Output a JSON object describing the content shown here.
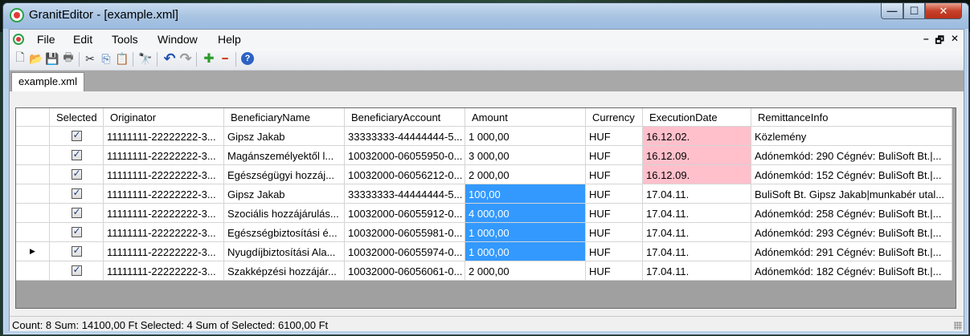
{
  "window": {
    "title": "GranitEditor - [example.xml]",
    "caption_min": "—",
    "caption_max": "☐",
    "caption_close": "✕"
  },
  "menu": [
    "File",
    "Edit",
    "Tools",
    "Window",
    "Help"
  ],
  "mdi_controls": [
    "–",
    "🗗",
    "✕"
  ],
  "toolbar": [
    {
      "name": "new-icon",
      "glyph": "🗋"
    },
    {
      "name": "open-icon",
      "glyph": "📂"
    },
    {
      "name": "save-icon",
      "glyph": "💾"
    },
    {
      "name": "print-icon",
      "glyph": "🖶"
    },
    {
      "name": "cut-icon",
      "glyph": "✂"
    },
    {
      "name": "copy-icon",
      "glyph": "⎘"
    },
    {
      "name": "paste-icon",
      "glyph": "📋"
    },
    {
      "name": "find-icon",
      "glyph": "🔭"
    },
    {
      "name": "undo-icon",
      "glyph": "↶"
    },
    {
      "name": "redo-icon",
      "glyph": "↷"
    },
    {
      "name": "add-icon",
      "glyph": "✚"
    },
    {
      "name": "remove-icon",
      "glyph": "━"
    },
    {
      "name": "help-icon",
      "glyph": "?"
    }
  ],
  "tab": {
    "label": "example.xml"
  },
  "grid": {
    "columns": [
      "Selected",
      "Originator",
      "BeneficiaryName",
      "BeneficiaryAccount",
      "Amount",
      "Currency",
      "ExecutionDate",
      "RemittanceInfo"
    ],
    "rows": [
      {
        "selected": true,
        "originator": "11111111-22222222-3...",
        "name": "Gipsz Jakab",
        "account": "33333333-44444444-5...",
        "amount": "1 000,00",
        "currency": "HUF",
        "date": "16.12.02.",
        "info": "Közlemény",
        "amount_sel": false,
        "date_pink": true,
        "current": false
      },
      {
        "selected": true,
        "originator": "11111111-22222222-3...",
        "name": "Magánszemélyektől l...",
        "account": "10032000-06055950-0...",
        "amount": "3 000,00",
        "currency": "HUF",
        "date": "16.12.09.",
        "info": "Adónemkód: 290 Cégnév: BuliSoft Bt.|...",
        "amount_sel": false,
        "date_pink": true,
        "current": false
      },
      {
        "selected": true,
        "originator": "11111111-22222222-3...",
        "name": "Egészségügyi hozzáj...",
        "account": "10032000-06056212-0...",
        "amount": "2 000,00",
        "currency": "HUF",
        "date": "16.12.09.",
        "info": "Adónemkód: 152 Cégnév: BuliSoft Bt.|...",
        "amount_sel": false,
        "date_pink": true,
        "current": false
      },
      {
        "selected": true,
        "originator": "11111111-22222222-3...",
        "name": "Gipsz Jakab",
        "account": "33333333-44444444-5...",
        "amount": "100,00",
        "currency": "HUF",
        "date": "17.04.11.",
        "info": "BuliSoft Bt. Gipsz Jakab|munkabér utal...",
        "amount_sel": true,
        "date_pink": false,
        "current": false
      },
      {
        "selected": true,
        "originator": "11111111-22222222-3...",
        "name": "Szociális hozzájárulás...",
        "account": "10032000-06055912-0...",
        "amount": "4 000,00",
        "currency": "HUF",
        "date": "17.04.11.",
        "info": "Adónemkód: 258 Cégnév: BuliSoft Bt.|...",
        "amount_sel": true,
        "date_pink": false,
        "current": false
      },
      {
        "selected": true,
        "originator": "11111111-22222222-3...",
        "name": "Egészségbiztosítási é...",
        "account": "10032000-06055981-0...",
        "amount": "1 000,00",
        "currency": "HUF",
        "date": "17.04.11.",
        "info": "Adónemkód: 293 Cégnév: BuliSoft Bt.|...",
        "amount_sel": true,
        "date_pink": false,
        "current": false
      },
      {
        "selected": true,
        "originator": "11111111-22222222-3...",
        "name": "Nyugdíjbiztosítási Ala...",
        "account": "10032000-06055974-0...",
        "amount": "1 000,00",
        "currency": "HUF",
        "date": "17.04.11.",
        "info": "Adónemkód: 291 Cégnév: BuliSoft Bt.|...",
        "amount_sel": true,
        "date_pink": false,
        "current": true
      },
      {
        "selected": true,
        "originator": "11111111-22222222-3...",
        "name": "Szakképzési hozzájár...",
        "account": "10032000-06056061-0...",
        "amount": "2 000,00",
        "currency": "HUF",
        "date": "17.04.11.",
        "info": "Adónemkód: 182 Cégnév: BuliSoft Bt.|...",
        "amount_sel": false,
        "date_pink": false,
        "current": false
      }
    ]
  },
  "status": {
    "text": "Count: 8  Sum: 14100,00 Ft  Selected: 4  Sum of Selected: 6100,00 Ft"
  },
  "colors": {
    "selection": "#3399ff",
    "overdue": "#ffc0cb"
  }
}
